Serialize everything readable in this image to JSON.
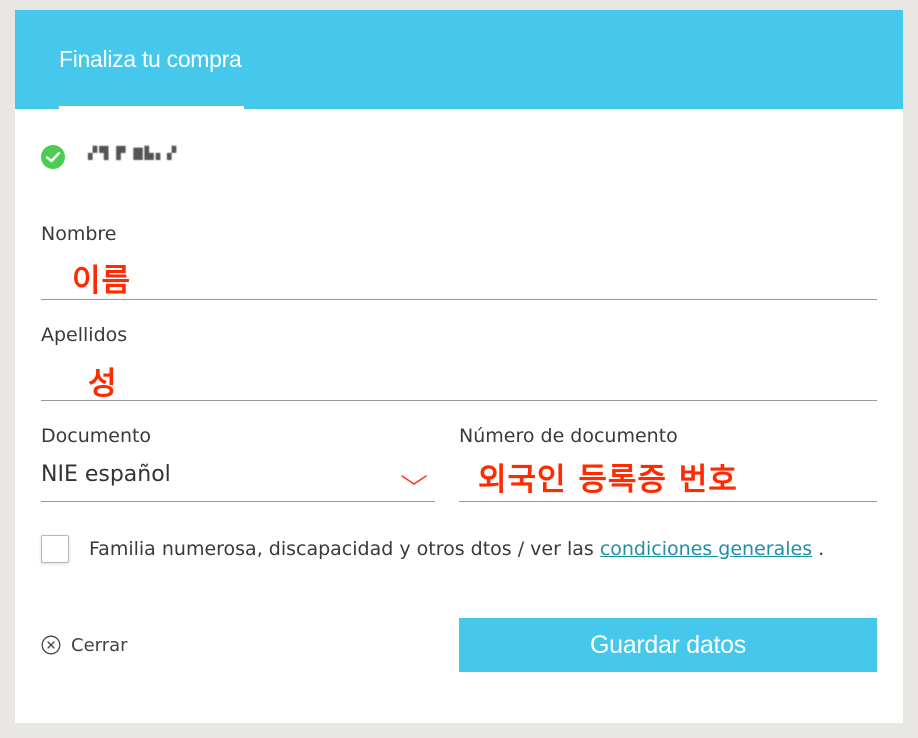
{
  "header": {
    "tab_label": "Finaliza tu compra"
  },
  "user": {
    "masked_name": "▞▜ ▛ ▇▙▖▞"
  },
  "form": {
    "nombre": {
      "label": "Nombre",
      "annotation": "이름"
    },
    "apellidos": {
      "label": "Apellidos",
      "annotation": "성"
    },
    "documento": {
      "label": "Documento",
      "value": "NIE español"
    },
    "numero": {
      "label": "Número de documento",
      "annotation": "외국인 등록증 번호"
    }
  },
  "terms": {
    "text": "Familia numerosa, discapacidad y otros dtos / ver las ",
    "link": "condiciones generales",
    "suffix": " ."
  },
  "actions": {
    "close_label": "Cerrar",
    "save_label": "Guardar datos"
  },
  "colors": {
    "accent": "#45c8eb",
    "annotation": "#ff2a00",
    "check": "#4ccc52",
    "link": "#1f8fa8"
  }
}
